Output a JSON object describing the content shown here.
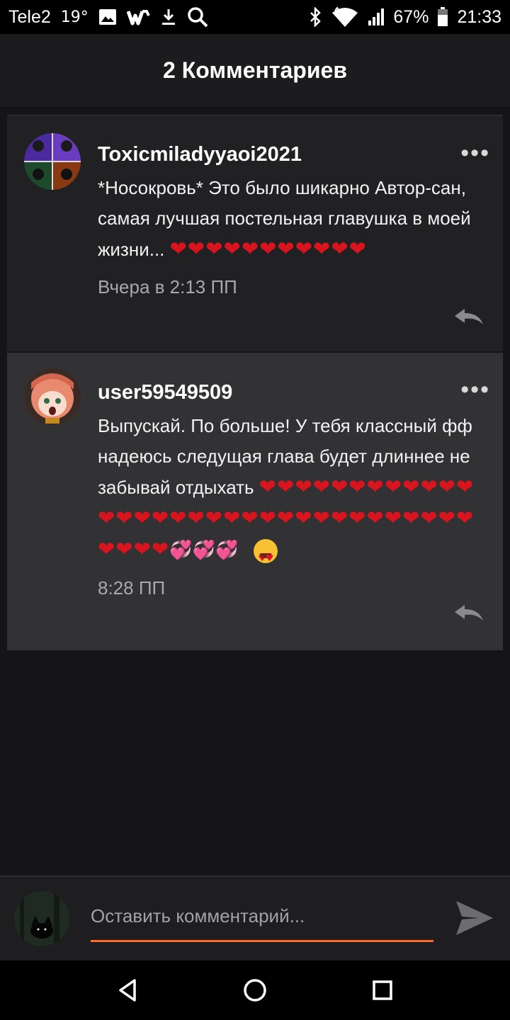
{
  "status_bar": {
    "carrier": "Tele2",
    "temperature": "19°",
    "battery": "67%",
    "time": "21:33",
    "icons": [
      "image-icon",
      "wattpad-icon",
      "download-icon",
      "search-icon",
      "bluetooth-icon",
      "wifi-icon",
      "signal-icon",
      "battery-icon"
    ]
  },
  "header": {
    "title": "2 Комментариев"
  },
  "comments": [
    {
      "username": "Toxicmiladyyaoi2021",
      "text": "*Носокровь* Это было шикарно Автор-сан, самая лучшая постельная главушка в моей жизни...",
      "emoji": "❤❤❤❤❤❤❤❤❤❤❤",
      "time": "Вчера в 2:13 ПП",
      "avatar_icon": "avatar-image"
    },
    {
      "username": "user59549509",
      "text": "Выпускай. По больше! У тебя классный фф надеюсь следущая глава будет длиннее не забывай отдыхать",
      "emoji": "❤❤❤❤❤❤❤❤❤❤❤❤❤❤❤❤❤❤❤❤❤❤❤❤❤❤❤❤❤❤❤❤❤❤❤❤❤",
      "emoji_extra": "💞💞💞",
      "time": "8:28 ПП",
      "avatar_icon": "avatar-image"
    }
  ],
  "input": {
    "placeholder": "Оставить комментарий..."
  },
  "nav": [
    "back-icon",
    "home-icon",
    "recents-icon"
  ],
  "colors": {
    "accent": "#ff6a2c",
    "heart": "#d8141f",
    "background": "#151416"
  }
}
